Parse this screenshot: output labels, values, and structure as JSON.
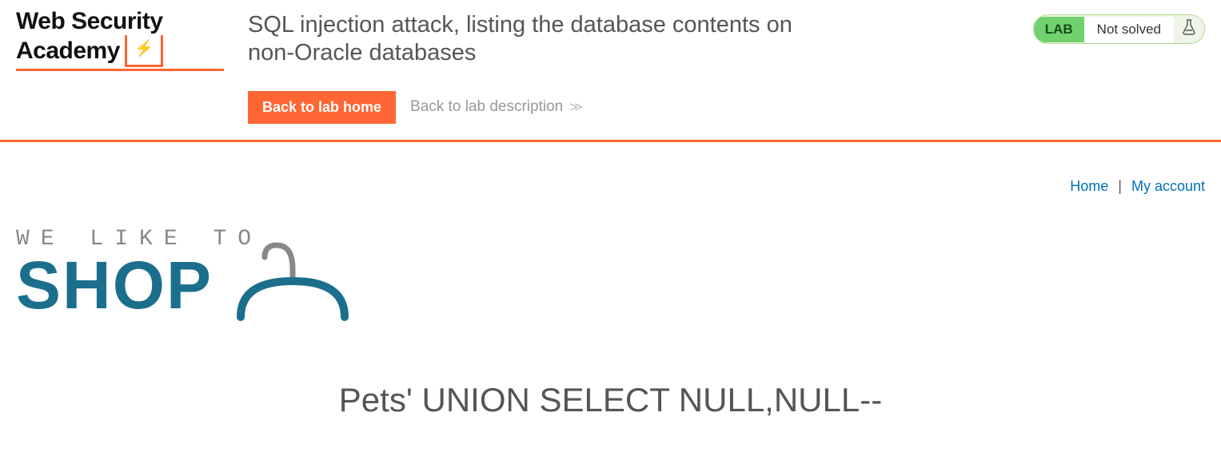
{
  "logo": {
    "line1": "Web Security",
    "line2": "Academy"
  },
  "lab_title": "SQL injection attack, listing the database contents on non-Oracle databases",
  "buttons": {
    "back_home": "Back to lab home",
    "back_desc": "Back to lab description"
  },
  "status": {
    "lab": "LAB",
    "state": "Not solved"
  },
  "nav": {
    "home": "Home",
    "account": "My account"
  },
  "shop": {
    "tagline": "WE LIKE TO",
    "big": "SHOP"
  },
  "page_heading": "Pets' UNION SELECT NULL,NULL--"
}
